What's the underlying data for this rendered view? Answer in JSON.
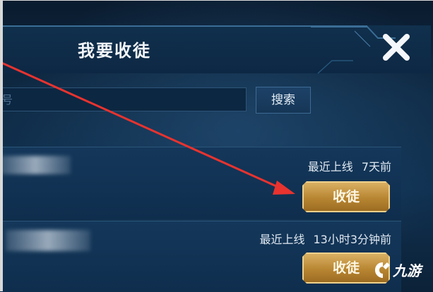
{
  "dialog": {
    "title": "我要收徒",
    "close_icon": "close-icon"
  },
  "search": {
    "placeholder_fragment": "号",
    "button_label": "搜索"
  },
  "candidates": [
    {
      "last_online_label": "最近上线",
      "last_online_value": "7天前",
      "action_label": "收徒"
    },
    {
      "last_online_label": "最近上线",
      "last_online_value": "13小时3分钟前",
      "action_label": "收徒"
    }
  ],
  "annotation": {
    "arrow_color": "#e8332f"
  },
  "watermark": {
    "text": "九游"
  },
  "colors": {
    "accent_gold": "#c8963f",
    "panel_blue": "#0f2b46"
  }
}
